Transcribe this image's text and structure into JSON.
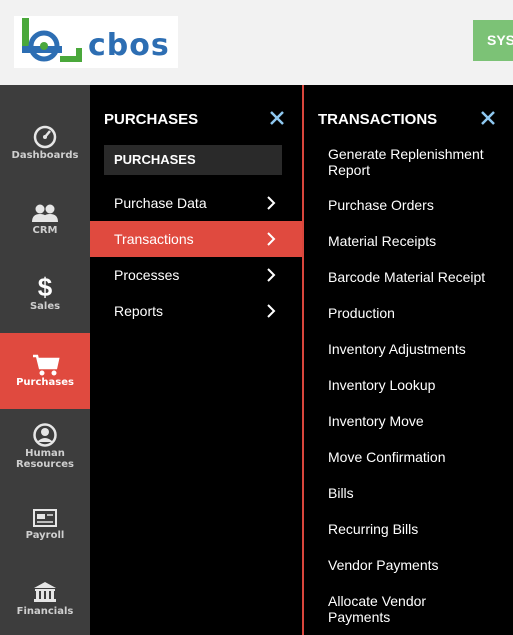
{
  "header": {
    "logo_text": "cbos",
    "system_button_label": "SYS"
  },
  "rail": {
    "items": [
      {
        "label": "Dashboards",
        "icon": "dashboard-icon"
      },
      {
        "label": "CRM",
        "icon": "users-icon"
      },
      {
        "label": "Sales",
        "icon": "dollar-icon"
      },
      {
        "label": "Purchases",
        "icon": "cart-icon",
        "active": true
      },
      {
        "label_line1": "Human",
        "label_line2": "Resources",
        "icon": "person-icon"
      },
      {
        "label": "Payroll",
        "icon": "payslip-icon"
      },
      {
        "label": "Financials",
        "icon": "bank-icon"
      }
    ]
  },
  "purchases_panel": {
    "title": "PURCHASES",
    "subheading": "PURCHASES",
    "items": [
      {
        "label": "Purchase Data"
      },
      {
        "label": "Transactions",
        "active": true
      },
      {
        "label": "Processes"
      },
      {
        "label": "Reports"
      }
    ]
  },
  "transactions_panel": {
    "title": "TRANSACTIONS",
    "items": [
      {
        "line1": "Generate Replenishment",
        "line2": "Report"
      },
      {
        "line1": "Purchase Orders"
      },
      {
        "line1": "Material Receipts"
      },
      {
        "line1": "Barcode Material Receipt"
      },
      {
        "line1": "Production"
      },
      {
        "line1": "Inventory Adjustments"
      },
      {
        "line1": "Inventory Lookup"
      },
      {
        "line1": "Inventory Move"
      },
      {
        "line1": "Move Confirmation"
      },
      {
        "line1": "Bills"
      },
      {
        "line1": "Recurring Bills"
      },
      {
        "line1": "Vendor Payments"
      },
      {
        "line1": "Allocate Vendor",
        "line2": "Payments"
      }
    ]
  },
  "colors": {
    "accent_red": "#e04a3f",
    "rail_bg": "#3d3d3d",
    "close_x": "#8fc8f0",
    "logo_green": "#4aa83b",
    "logo_blue": "#2d6eb3",
    "sys_green": "#7cc276"
  }
}
